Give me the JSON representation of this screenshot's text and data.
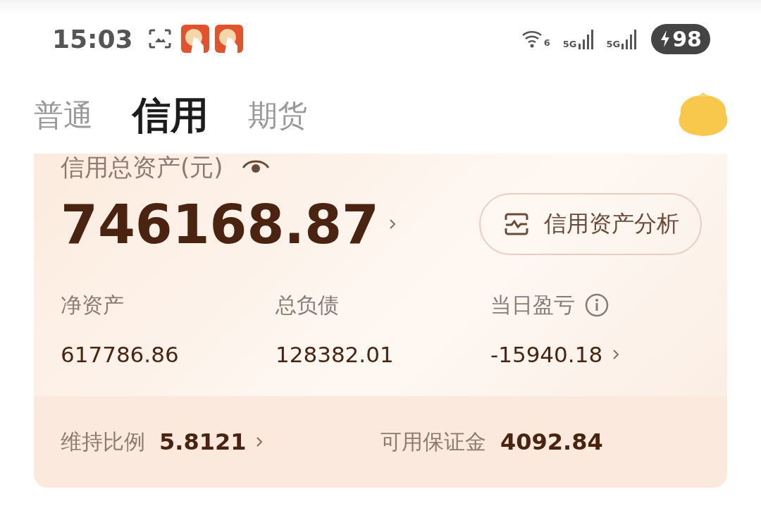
{
  "status_bar": {
    "time": "15:03",
    "wifi_label": "6",
    "networks": [
      "5G",
      "5G"
    ],
    "battery": "98"
  },
  "tabs": [
    {
      "label": "普通",
      "selected": false
    },
    {
      "label": "信用",
      "selected": true
    },
    {
      "label": "期货",
      "selected": false
    }
  ],
  "card": {
    "title": "信用总资产(元)",
    "total": "746168.87",
    "analysis_button": "信用资产分析",
    "stats": [
      {
        "label": "净资产",
        "value": "617786.86",
        "info": false,
        "link": false
      },
      {
        "label": "总负债",
        "value": "128382.01",
        "info": false,
        "link": false
      },
      {
        "label": "当日盈亏",
        "value": "-15940.18",
        "info": true,
        "link": true
      }
    ],
    "footer": [
      {
        "label": "维持比例",
        "value": "5.8121",
        "link": true
      },
      {
        "label": "可用保证金",
        "value": "4092.84",
        "link": false
      }
    ]
  }
}
